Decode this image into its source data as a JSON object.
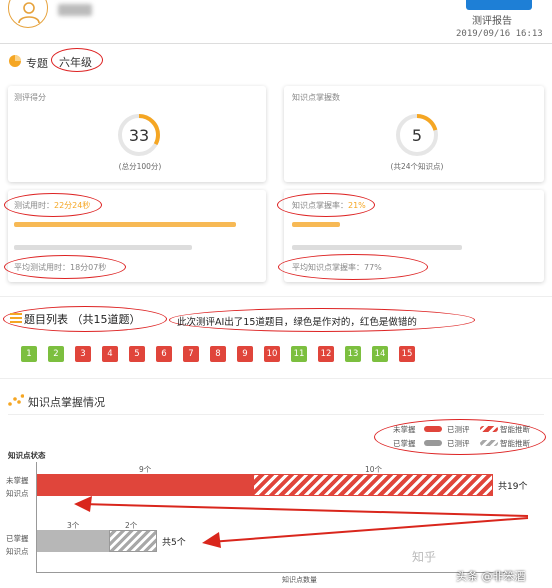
{
  "header": {
    "report_title": "测评报告",
    "report_date": "2019/09/16 16:13"
  },
  "topic": {
    "label": "专题",
    "grade": "六年级"
  },
  "score_card": {
    "title": "测评得分",
    "value": "33",
    "sub": "(总分100分)"
  },
  "knowledge_card": {
    "title": "知识点掌握数",
    "value": "5",
    "sub": "(共24个知识点)"
  },
  "time_card": {
    "used_label": "测试用时：",
    "used_value": "22分24秒",
    "avg_label": "平均测试用时：",
    "avg_value": "18分07秒"
  },
  "rate_card": {
    "rate_label": "知识点掌握率：",
    "rate_value": "21%",
    "avg_label": "平均知识点掌握率：",
    "avg_value": "77%"
  },
  "question_list": {
    "title": "题目列表 （共15道题）",
    "annotation": "此次测评AI出了15道题目，绿色是作对的，红色是做错的"
  },
  "questions": [
    {
      "n": "1",
      "c": "green"
    },
    {
      "n": "2",
      "c": "green"
    },
    {
      "n": "3",
      "c": "red"
    },
    {
      "n": "4",
      "c": "red"
    },
    {
      "n": "5",
      "c": "red"
    },
    {
      "n": "6",
      "c": "red"
    },
    {
      "n": "7",
      "c": "red"
    },
    {
      "n": "8",
      "c": "red"
    },
    {
      "n": "9",
      "c": "red"
    },
    {
      "n": "10",
      "c": "red"
    },
    {
      "n": "11",
      "c": "green"
    },
    {
      "n": "12",
      "c": "red"
    },
    {
      "n": "13",
      "c": "green"
    },
    {
      "n": "14",
      "c": "green"
    },
    {
      "n": "15",
      "c": "red"
    }
  ],
  "mastery": {
    "title": "知识点掌握情况",
    "status_label": "知识点状态",
    "axis_label": "知识点数量",
    "legend": {
      "unmastered": "未掌握",
      "mastered": "已掌握",
      "tested": "已测评",
      "ai": "智能推断"
    },
    "rows": [
      {
        "label1": "未掌握",
        "label2": "知识点",
        "tested": 9,
        "ai": 10,
        "tested_label": "9个",
        "ai_label": "10个",
        "total": "共19个"
      },
      {
        "label1": "已掌握",
        "label2": "知识点",
        "tested": 3,
        "ai": 2,
        "tested_label": "3个",
        "ai_label": "2个",
        "total": "共5个"
      }
    ]
  },
  "watermark": {
    "zhihu": "知乎",
    "toutiao": "头条 @非笨酒"
  },
  "colors": {
    "accent": "#f5a623",
    "red": "#e0453b",
    "green": "#7cbf3f",
    "annotation": "#d22222"
  }
}
